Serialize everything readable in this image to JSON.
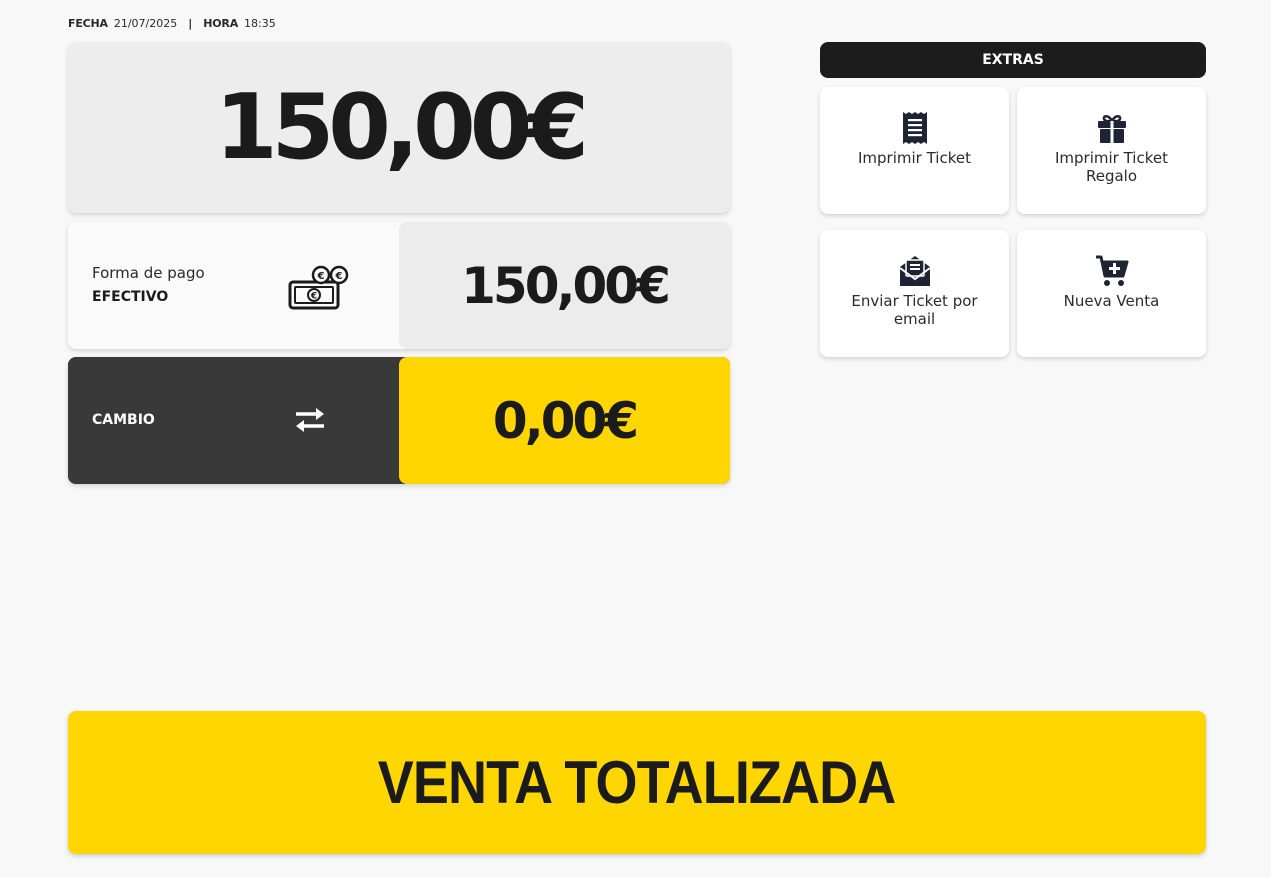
{
  "header": {
    "date_label": "FECHA",
    "date_value": "21/07/2025",
    "separator": "|",
    "time_label": "HORA",
    "time_value": "18:35"
  },
  "total": {
    "amount": "150,00€"
  },
  "payment": {
    "label": "Forma de pago",
    "method": "EFECTIVO",
    "icon": "cash-icon",
    "amount": "150,00€"
  },
  "change": {
    "label": "CAMBIO",
    "icon": "swap-arrows-icon",
    "amount": "0,00€"
  },
  "extras": {
    "title": "EXTRAS",
    "buttons": [
      {
        "label": "Imprimir Ticket",
        "icon": "receipt-icon"
      },
      {
        "label": "Imprimir Ticket Regalo",
        "icon": "gift-icon"
      },
      {
        "label": "Enviar Ticket por email",
        "icon": "envelope-icon"
      },
      {
        "label": "Nueva Venta",
        "icon": "cart-plus-icon"
      }
    ]
  },
  "finish": {
    "label": "VENTA TOTALIZADA"
  },
  "colors": {
    "accent_yellow": "#ffd600",
    "dark": "#393939",
    "extras_header": "#1c1c1c",
    "text": "#1b1b1b"
  }
}
